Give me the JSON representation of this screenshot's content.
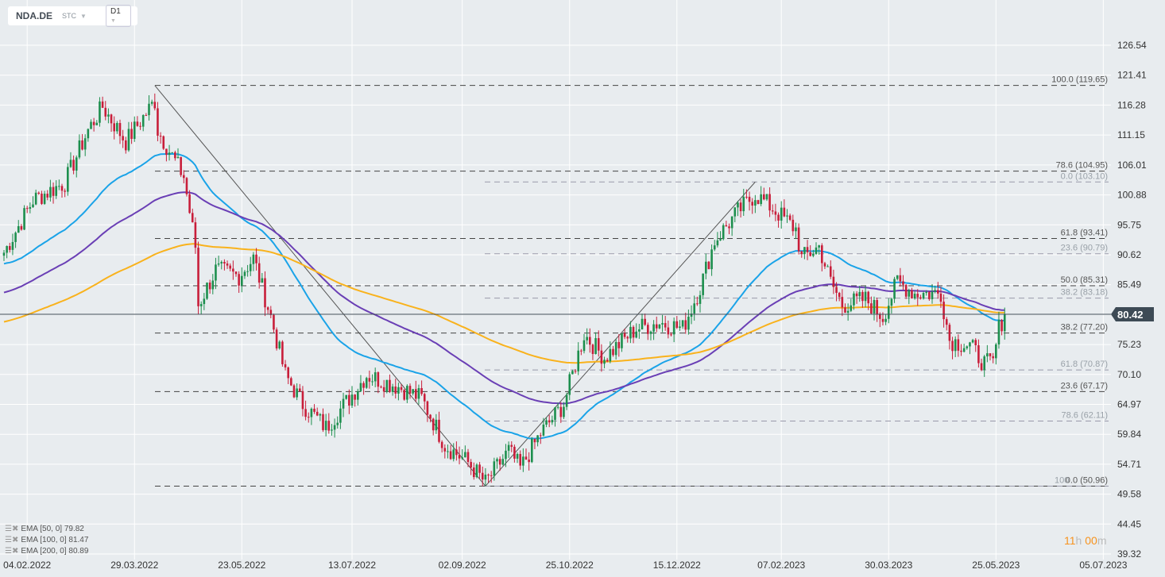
{
  "header": {
    "symbol": "NDA.DE",
    "type": "STC",
    "timeframe": "D1"
  },
  "legend": [
    {
      "label": "EMA [50,  0] 79.82",
      "color": "#1aa3e8"
    },
    {
      "label": "EMA [100,  0] 81.47",
      "color": "#6a3fb5"
    },
    {
      "label": "EMA [200,  0] 80.89",
      "color": "#f9b21c"
    }
  ],
  "timer": {
    "hours": "11",
    "h": "h",
    "minutes": "00",
    "m": "m"
  },
  "chart_data": {
    "type": "candlestick",
    "price_ticks": [
      "126.54",
      "121.41",
      "116.28",
      "111.15",
      "106.01",
      "100.88",
      "95.75",
      "90.62",
      "85.49",
      "80.36",
      "75.23",
      "70.10",
      "64.97",
      "59.84",
      "54.71",
      "49.58",
      "44.45",
      "39.32"
    ],
    "ylim": [
      39.32,
      126.54
    ],
    "date_ticks": [
      {
        "bar": 8,
        "label": "04.02.2022"
      },
      {
        "bar": 45,
        "label": "29.03.2022"
      },
      {
        "bar": 82,
        "label": "23.05.2022"
      },
      {
        "bar": 120,
        "label": "13.07.2022"
      },
      {
        "bar": 158,
        "label": "02.09.2022"
      },
      {
        "bar": 195,
        "label": "25.10.2022"
      },
      {
        "bar": 232,
        "label": "15.12.2022"
      },
      {
        "bar": 268,
        "label": "07.02.2023"
      },
      {
        "bar": 305,
        "label": "30.03.2023"
      },
      {
        "bar": 342,
        "label": "25.05.2023"
      },
      {
        "bar": 379,
        "label": "05.07.2023"
      }
    ],
    "last_price": "80.42",
    "close_anchors": [
      [
        0,
        91
      ],
      [
        10,
        100
      ],
      [
        21,
        103
      ],
      [
        29,
        112
      ],
      [
        34,
        116
      ],
      [
        42,
        110
      ],
      [
        52,
        117
      ],
      [
        53,
        112
      ],
      [
        62,
        104
      ],
      [
        66,
        92
      ],
      [
        67,
        82
      ],
      [
        73,
        88
      ],
      [
        81,
        87
      ],
      [
        86,
        90
      ],
      [
        92,
        80
      ],
      [
        97,
        70
      ],
      [
        103,
        65
      ],
      [
        111,
        61
      ],
      [
        119,
        66
      ],
      [
        125,
        70
      ],
      [
        136,
        68
      ],
      [
        144,
        66
      ],
      [
        152,
        58
      ],
      [
        160,
        55
      ],
      [
        166,
        51.5
      ],
      [
        174,
        57
      ],
      [
        178,
        54
      ],
      [
        185,
        60
      ],
      [
        193,
        65
      ],
      [
        200,
        77
      ],
      [
        207,
        73
      ],
      [
        218,
        78
      ],
      [
        226,
        79
      ],
      [
        234,
        78
      ],
      [
        240,
        85
      ],
      [
        245,
        93
      ],
      [
        253,
        98
      ],
      [
        259,
        101
      ],
      [
        264,
        99
      ],
      [
        273,
        95
      ],
      [
        275,
        90
      ],
      [
        281,
        92
      ],
      [
        285,
        86
      ],
      [
        289,
        82
      ],
      [
        297,
        83
      ],
      [
        303,
        80
      ],
      [
        308,
        86
      ],
      [
        314,
        84
      ],
      [
        323,
        84
      ],
      [
        326,
        76
      ],
      [
        333,
        75
      ],
      [
        338,
        72
      ],
      [
        341,
        72
      ],
      [
        343,
        78
      ],
      [
        345,
        80.4
      ]
    ],
    "ema_start": {
      "ema50": 89,
      "ema100": 84,
      "ema200": 79
    },
    "fib_dark": [
      {
        "price": 119.65,
        "label": "100.0 (119.65)"
      },
      {
        "price": 104.95,
        "label": "78.6 (104.95)"
      },
      {
        "price": 93.41,
        "label": "61.8 (93.41)"
      },
      {
        "price": 85.31,
        "label": "50.0 (85.31)"
      },
      {
        "price": 77.2,
        "label": "38.2 (77.20)"
      },
      {
        "price": 67.17,
        "label": "23.6 (67.17)"
      },
      {
        "price": 50.96,
        "label": "0.0 (50.96)"
      }
    ],
    "fib_light": [
      {
        "price": 103.1,
        "label": "0.0 (103.10)"
      },
      {
        "price": 90.79,
        "label": "23.6 (90.79)"
      },
      {
        "price": 83.18,
        "label": "38.2 (83.18)"
      },
      {
        "price": 70.87,
        "label": "61.8 (70.87)"
      },
      {
        "price": 62.11,
        "label": "78.6 (62.11)"
      },
      {
        "price": 50.96,
        "label": "100"
      }
    ],
    "trend_lines": [
      [
        [
          52,
          119.65
        ],
        [
          166,
          50.96
        ]
      ],
      [
        [
          166,
          50.96
        ],
        [
          259,
          103.1
        ]
      ]
    ]
  }
}
